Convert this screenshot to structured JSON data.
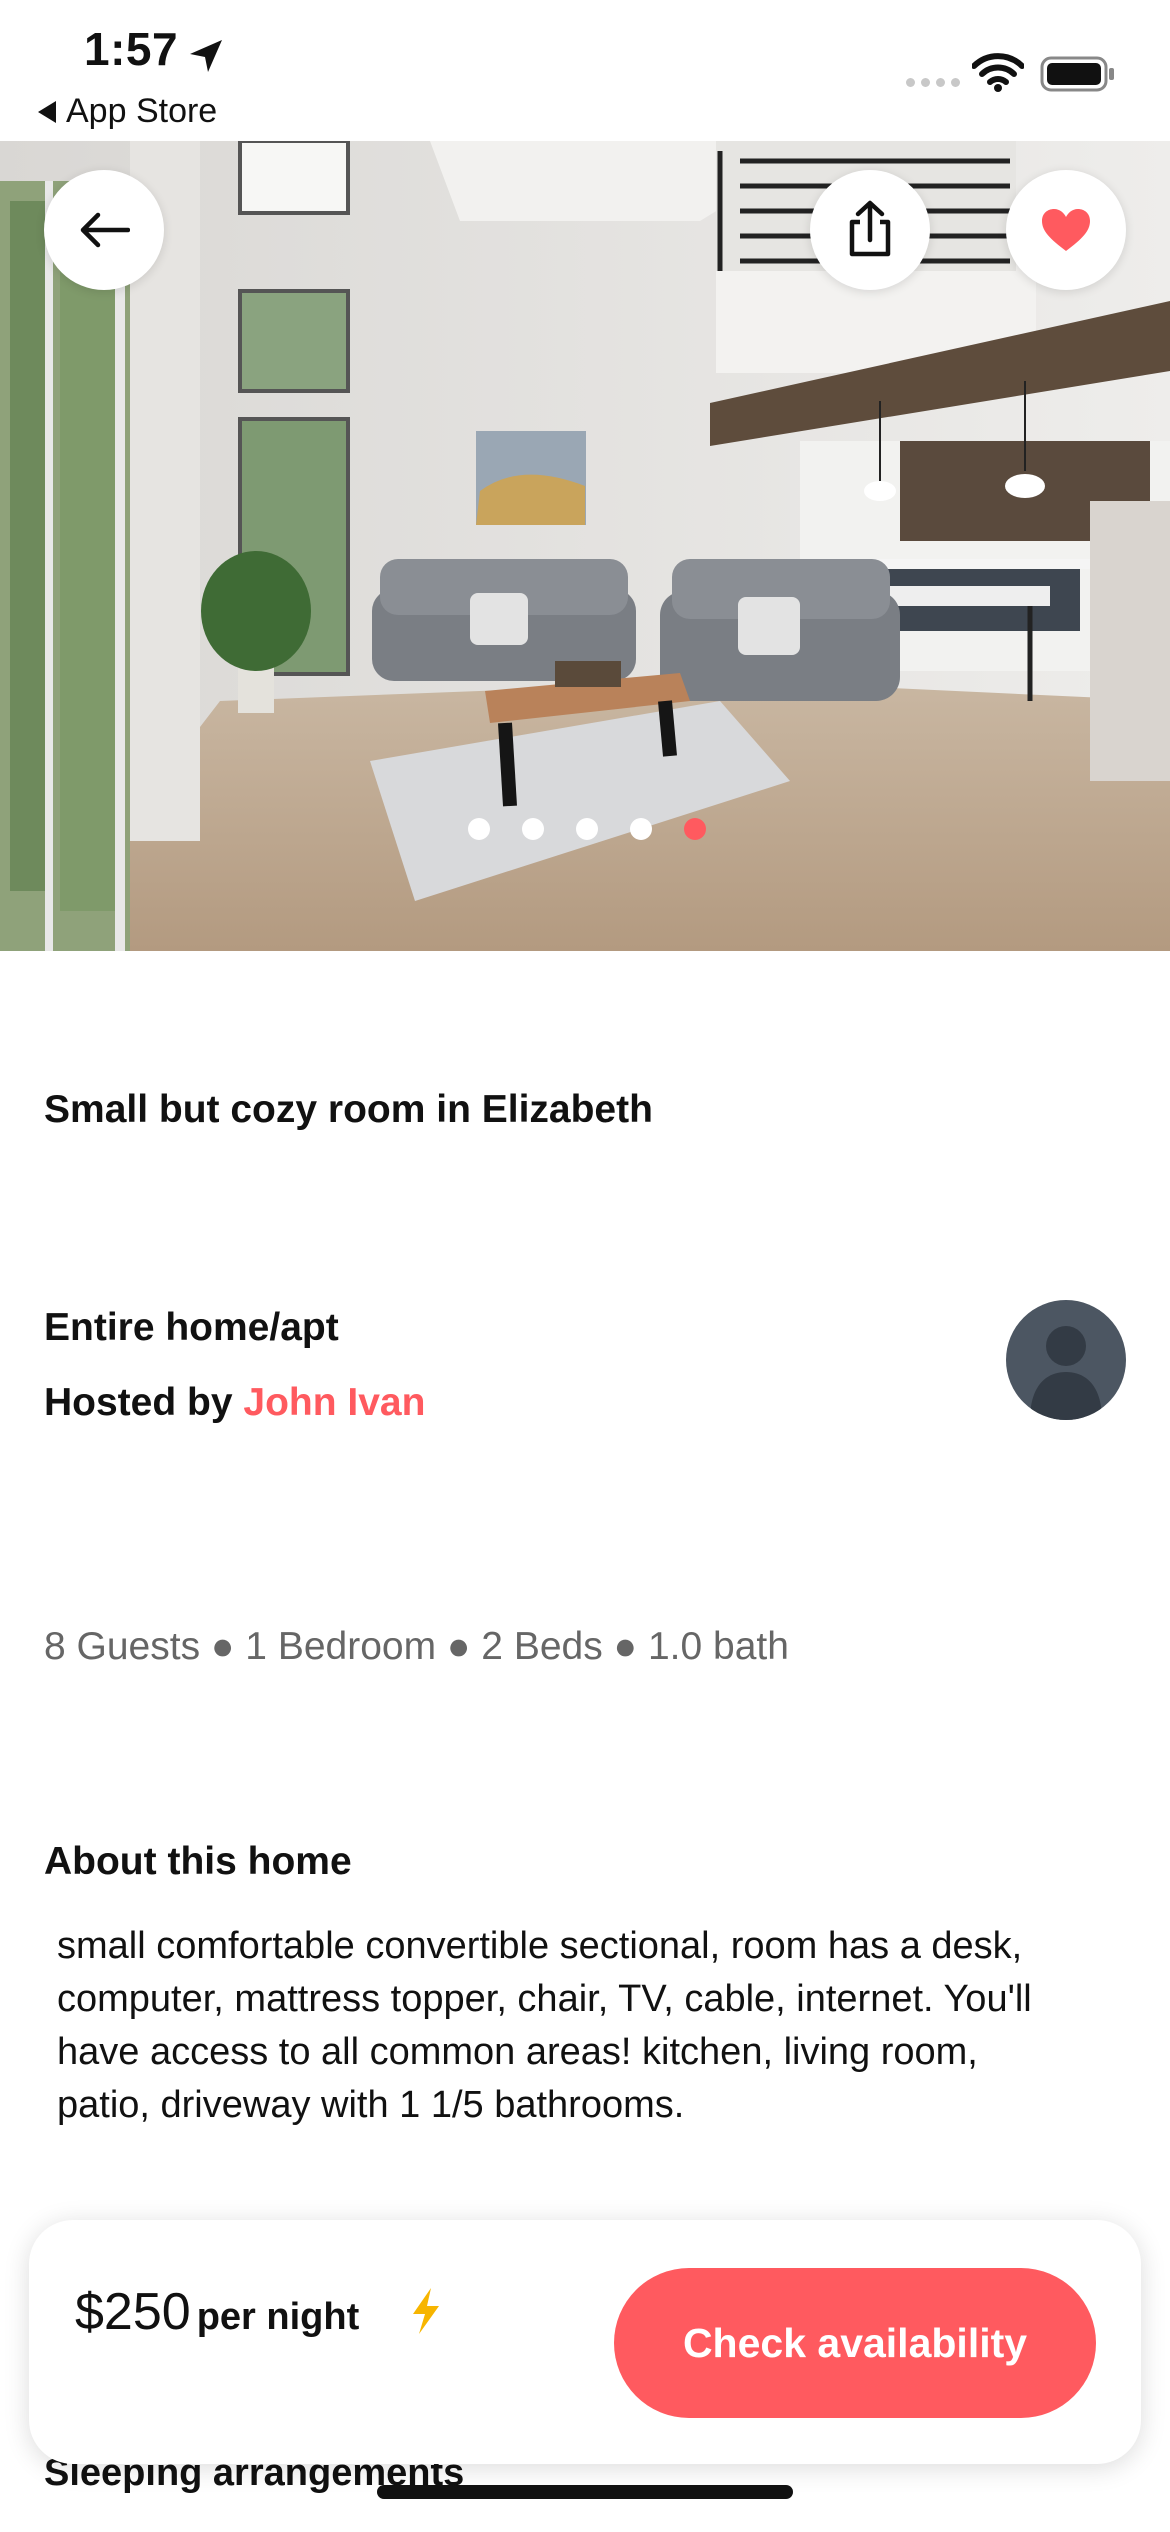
{
  "status_bar": {
    "time": "1:57",
    "back_label": "App Store"
  },
  "hero": {
    "carousel_count": 5,
    "active_index": 4,
    "favorited": true
  },
  "listing": {
    "title": "Small but cozy room in Elizabeth",
    "room_type": "Entire home/apt",
    "hosted_by_label": "Hosted by",
    "host_name": "John Ivan",
    "specs": "8 Guests ● 1 Bedroom ● 2 Beds ● 1.0 bath",
    "about_heading": "About this home",
    "about_text": "small comfortable convertible sectional, room has a desk, computer, mattress topper, chair, TV, cable, internet. You'll have access to all common areas! kitchen, living room, patio, driveway with 1 1/5 bathrooms.",
    "next_section_heading": "Sleeping arrangements"
  },
  "booking_bar": {
    "price": "$250",
    "per_night_label": "per night",
    "cta_label": "Check availability"
  },
  "colors": {
    "accent": "#ff5a5f",
    "bolt": "#f7b500",
    "avatar_bg": "#4c5662"
  }
}
